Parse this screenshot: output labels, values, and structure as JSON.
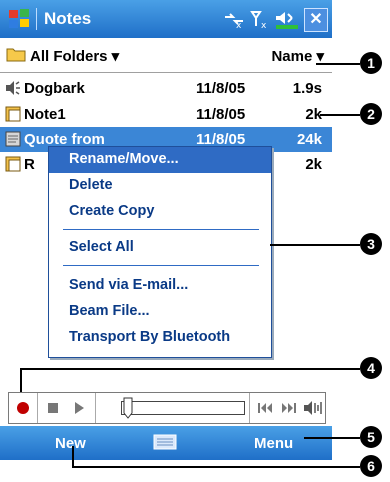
{
  "titlebar": {
    "app_title": "Notes",
    "close_label": "✕"
  },
  "folder_header": {
    "folder_label": "All Folders ▾",
    "sort_label": "Name ▾"
  },
  "files": [
    {
      "icon": "speaker-icon",
      "name": "Dogbark",
      "date": "11/8/05",
      "size": "1.9s"
    },
    {
      "icon": "note-icon",
      "name": "Note1",
      "date": "11/8/05",
      "size": "2k"
    },
    {
      "icon": "note-icon",
      "name": "Quote from",
      "date": "11/8/05",
      "size": "24k"
    },
    {
      "icon": "note-icon",
      "name": "R",
      "date": "",
      "size": "2k"
    }
  ],
  "context_menu": {
    "items": [
      "Rename/Move...",
      "Delete",
      "Create Copy",
      "Select All",
      "Send via E-mail...",
      "Beam File...",
      "Transport By Bluetooth"
    ]
  },
  "menubar": {
    "left_label": "New",
    "right_label": "Menu"
  },
  "callouts": [
    "1",
    "2",
    "3",
    "4",
    "5",
    "6"
  ],
  "colors": {
    "titlebar": "#1f6fc8",
    "selection": "#3b86d6",
    "menu_text": "#0a3a86",
    "record": "#c00000"
  }
}
